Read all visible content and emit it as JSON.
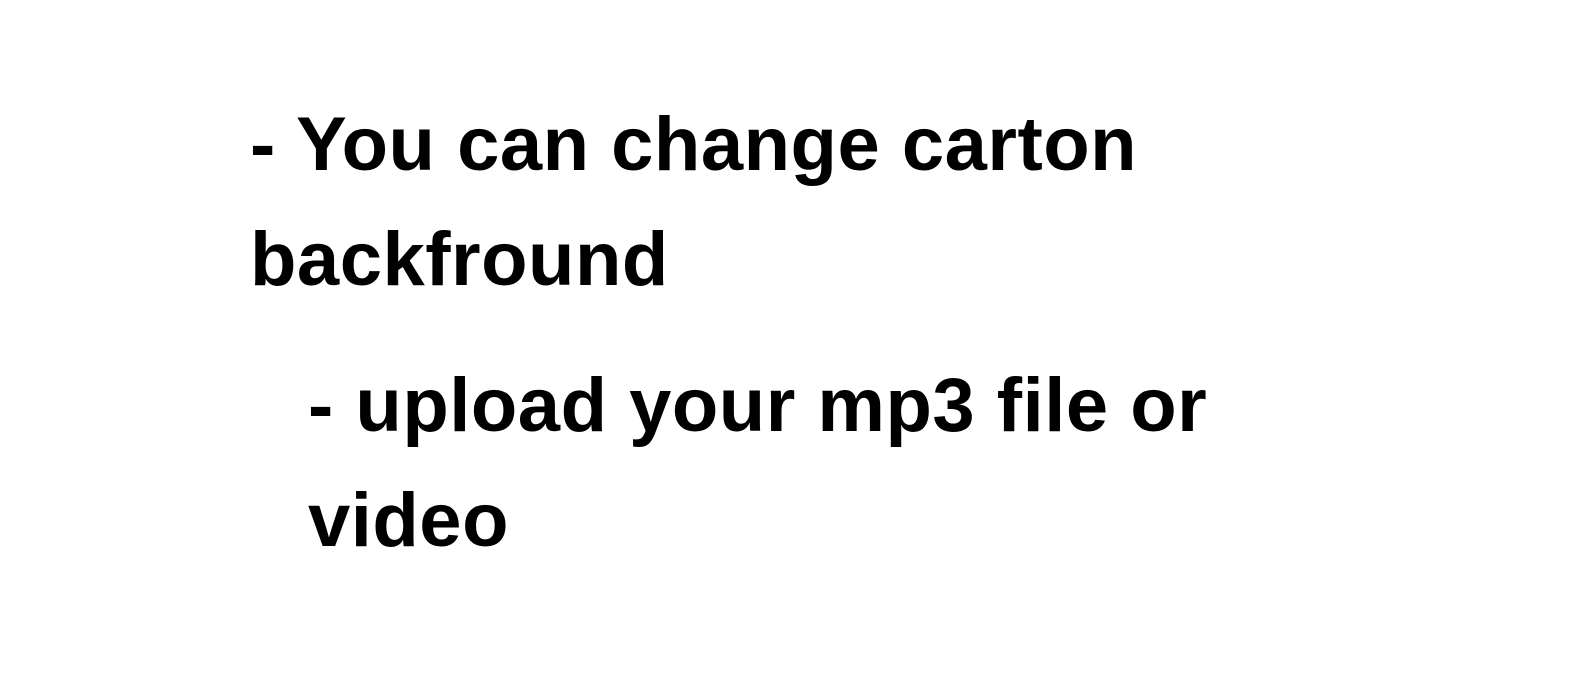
{
  "notes": [
    {
      "lines": [
        "- You can change carton",
        "backfround"
      ]
    },
    {
      "lines": [
        "- upload your mp3 file or",
        "video"
      ]
    }
  ],
  "colors": {
    "background": "#ffffff",
    "text": "#000000"
  }
}
